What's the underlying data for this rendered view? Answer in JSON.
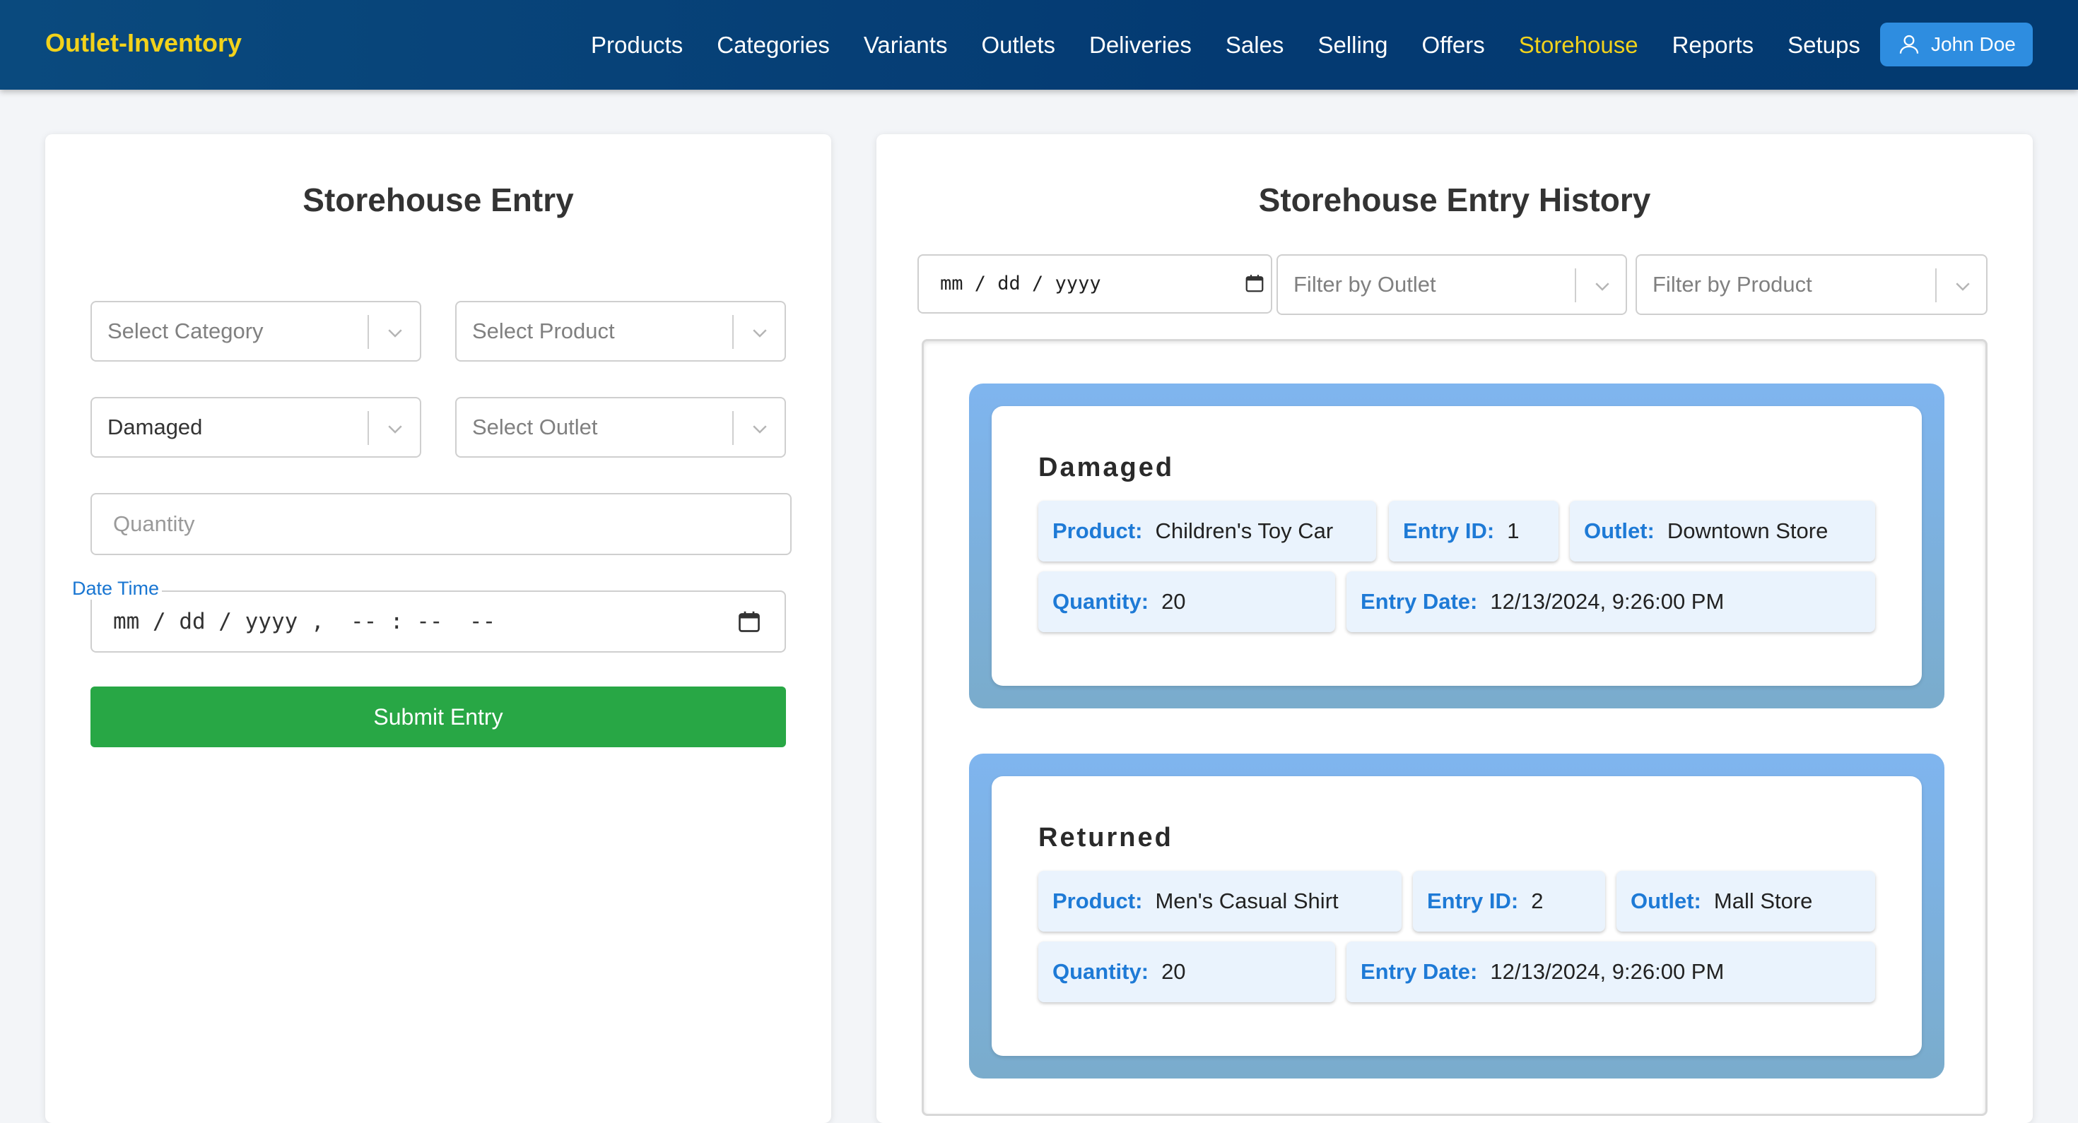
{
  "brand": "Outlet-Inventory",
  "nav": {
    "items": [
      "Products",
      "Categories",
      "Variants",
      "Outlets",
      "Deliveries",
      "Sales",
      "Selling",
      "Offers",
      "Storehouse",
      "Reports",
      "Setups"
    ],
    "active": "Storehouse"
  },
  "user": {
    "name": "John Doe",
    "icon": "user-icon"
  },
  "entry_form": {
    "title": "Storehouse Entry",
    "category_placeholder": "Select Category",
    "product_placeholder": "Select Product",
    "type_value": "Damaged",
    "outlet_placeholder": "Select Outlet",
    "quantity_placeholder": "Quantity",
    "datetime_label": "Date Time",
    "datetime_placeholder": "mm / dd / yyyy ,  -- : --  --",
    "submit_label": "Submit Entry"
  },
  "history": {
    "title": "Storehouse Entry History",
    "date_filter_placeholder": "mm / dd / yyyy",
    "outlet_filter_placeholder": "Filter by Outlet",
    "product_filter_placeholder": "Filter by Product",
    "labels": {
      "product": "Product:",
      "entry_id": "Entry ID:",
      "outlet": "Outlet:",
      "quantity": "Quantity:",
      "entry_date": "Entry Date:"
    },
    "entries": [
      {
        "type": "Damaged",
        "product": "Children's Toy Car",
        "entry_id": "1",
        "outlet": "Downtown Store",
        "quantity": "20",
        "entry_date": "12/13/2024, 9:26:00 PM"
      },
      {
        "type": "Returned",
        "product": "Men's Casual Shirt",
        "entry_id": "2",
        "outlet": "Mall Store",
        "quantity": "20",
        "entry_date": "12/13/2024, 9:26:00 PM"
      }
    ]
  },
  "colors": {
    "nav_bg": "#043a72",
    "brand": "#f2d21b",
    "active_nav": "#f2d21b",
    "user_button": "#2e8de0",
    "submit": "#28a745",
    "chip_label": "#1e7ad6",
    "chip_bg": "#eaf3fd"
  }
}
